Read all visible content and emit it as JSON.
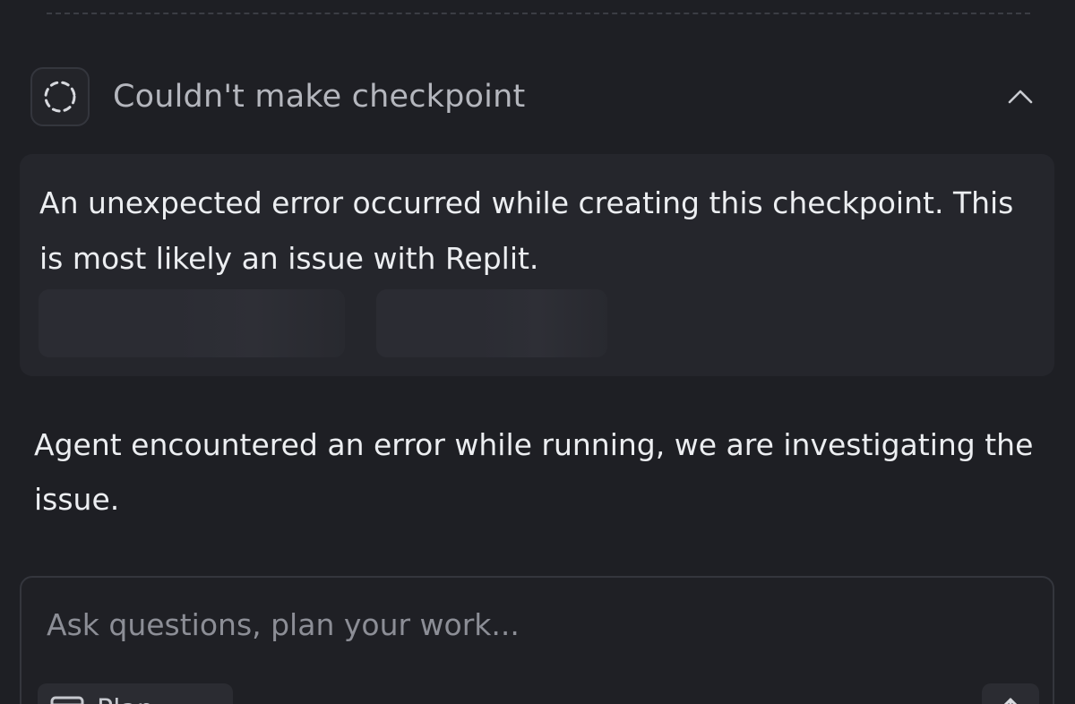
{
  "checkpoint": {
    "title": "Couldn't make checkpoint",
    "error_message": "An unexpected error occurred while creating this checkpoint. This is most likely an issue with Replit."
  },
  "agent": {
    "message": "Agent encountered an error while running, we are investigating the issue."
  },
  "composer": {
    "placeholder": "Ask questions, plan your work...",
    "mode_label": "Plan"
  },
  "icons": {
    "checkpoint": "dashed-circle-icon",
    "collapse": "chevron-up-icon",
    "mode": "window-icon",
    "send": "arrow-up-icon"
  },
  "colors": {
    "background": "#1e1f24",
    "card": "#25262c",
    "text_primary": "#eceef1",
    "text_muted": "#b4b6bd",
    "placeholder": "#8c8e96"
  }
}
